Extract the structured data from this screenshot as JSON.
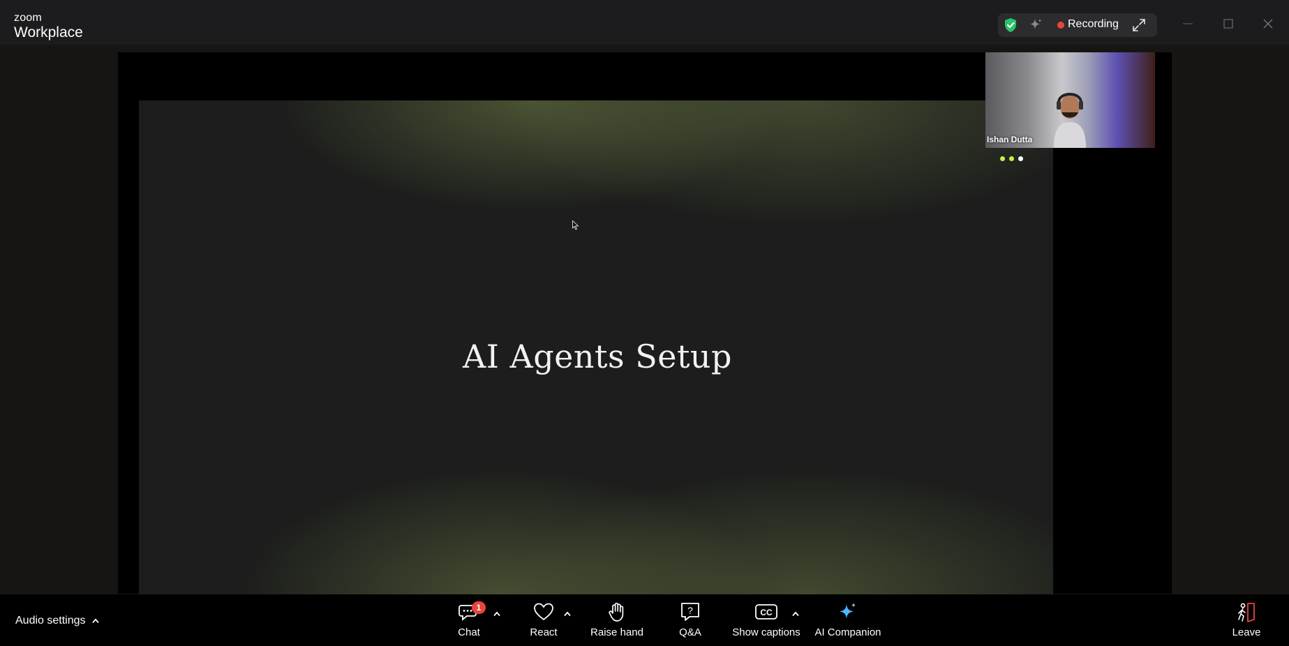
{
  "app": {
    "brand": "zoom",
    "product": "Workplace"
  },
  "header": {
    "recording_label": "Recording",
    "icons": [
      "shield-check-icon",
      "sparkle-icon",
      "expand-icon"
    ],
    "window_controls": [
      "minimize-icon",
      "maximize-icon",
      "close-icon"
    ]
  },
  "share": {
    "slide_title": "AI Agents Setup"
  },
  "participant": {
    "name": "Ishan Dutta",
    "status_dot_colors": [
      "#c6f04a",
      "#c6f04a",
      "#ffffff"
    ]
  },
  "toolbar": {
    "audio_settings_label": "Audio settings",
    "chat_label": "Chat",
    "chat_badge": "1",
    "react_label": "React",
    "raise_hand_label": "Raise hand",
    "qa_label": "Q&A",
    "captions_label": "Show captions",
    "ai_companion_label": "AI Companion",
    "leave_label": "Leave"
  },
  "colors": {
    "recording_dot": "#e8453c",
    "shield": "#27c46b",
    "ai_companion": "#4fb6ff",
    "leave_door": "#e8453c",
    "chat_badge": "#e8453c"
  }
}
